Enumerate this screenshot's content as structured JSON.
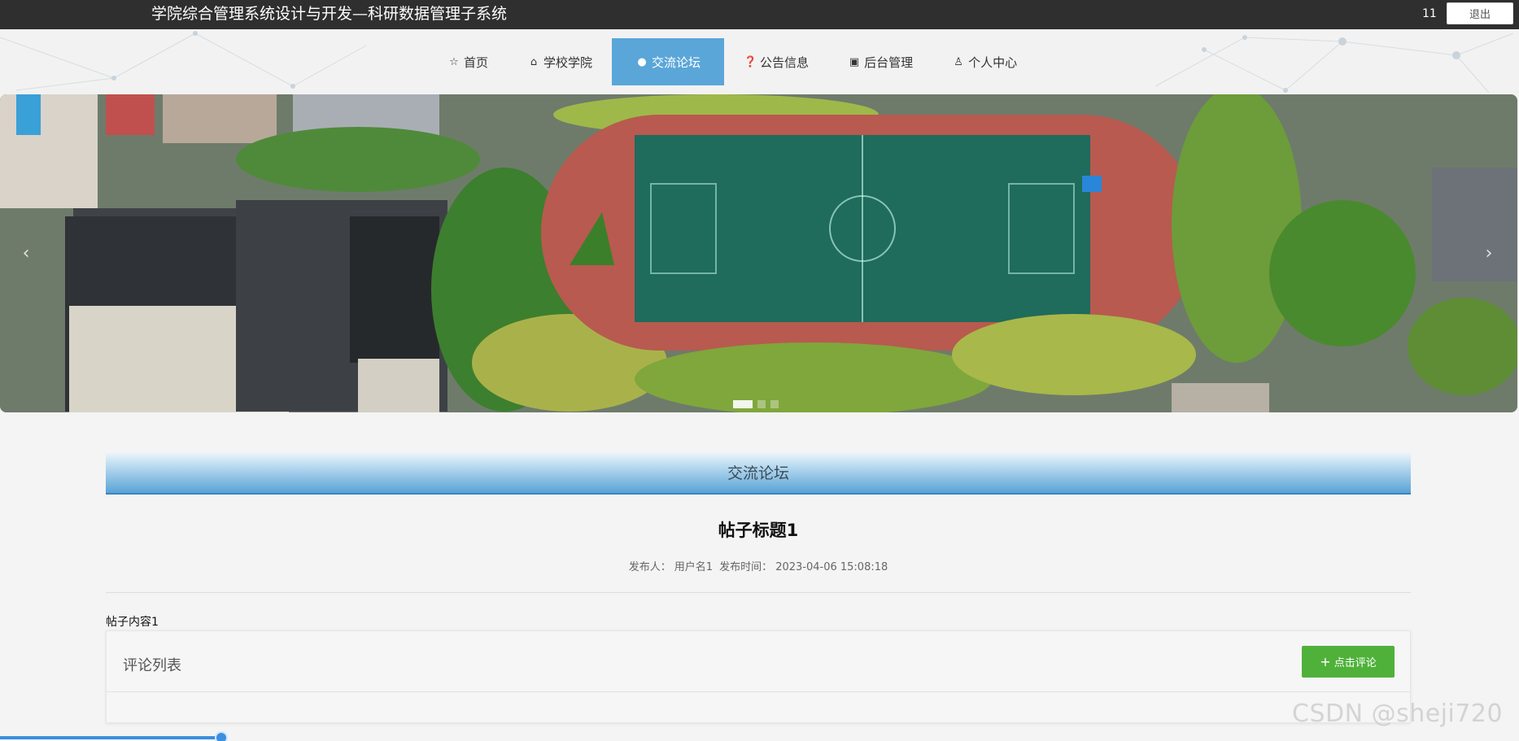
{
  "header": {
    "title": "学院综合管理系统设计与开发—科研数据管理子系统",
    "username": "11",
    "logout_label": "退出"
  },
  "nav": {
    "items": [
      {
        "label": "首页",
        "icon": "star-icon"
      },
      {
        "label": "学校学院",
        "icon": "bag-icon"
      },
      {
        "label": "交流论坛",
        "icon": "info-circle-icon",
        "active": true
      },
      {
        "label": "公告信息",
        "icon": "question-circle-icon"
      },
      {
        "label": "后台管理",
        "icon": "briefcase-icon"
      },
      {
        "label": "个人中心",
        "icon": "user-icon"
      }
    ],
    "active_color": "#5aa6d9"
  },
  "banner": {
    "image_label": "campus aerial photo with sports field",
    "slides": 3,
    "active_slide": 1
  },
  "section": {
    "title": "交流论坛"
  },
  "post": {
    "title": "帖子标题1",
    "author_label": "发布人：",
    "author": "用户名1",
    "time_label": "发布时间：",
    "time": "2023-04-06 15:08:18",
    "content": "帖子内容1"
  },
  "comments": {
    "title": "评论列表",
    "button_label": "点击评论",
    "button_color": "#4fb13a"
  },
  "watermark": "CSDN @sheji720"
}
